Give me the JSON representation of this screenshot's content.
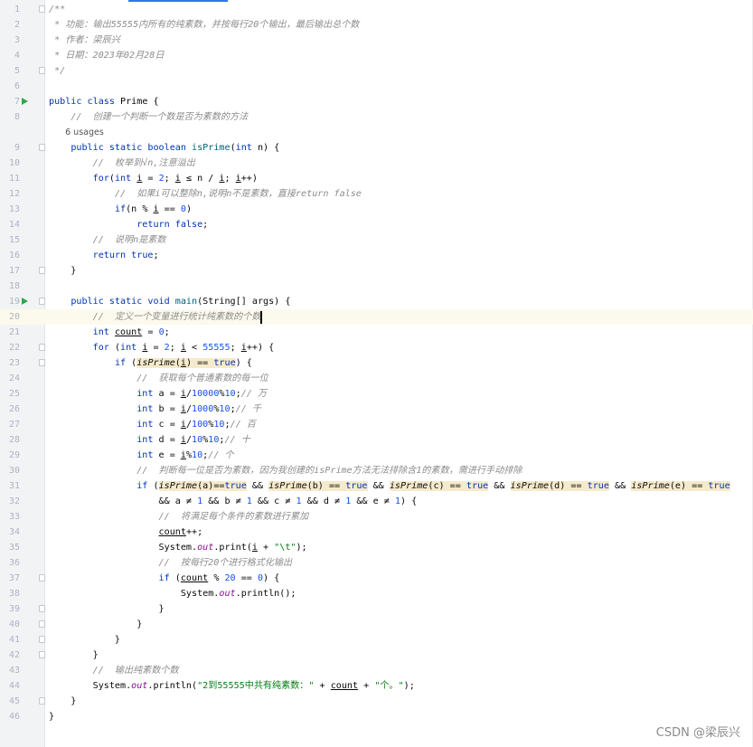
{
  "editor": {
    "language": "Java",
    "caret_line": 20,
    "run_lines": [
      7,
      19
    ],
    "fold_lines": [
      1,
      5,
      9,
      17,
      19,
      22,
      23,
      37,
      39,
      40,
      41,
      42,
      45
    ],
    "usages_before_line": 9,
    "usages_label": "6 usages",
    "lines": [
      [
        [
          "c",
          "/**"
        ]
      ],
      [
        [
          "c",
          " * 功能：输出55555内所有的纯素数，并按每行20个输出，最后输出总个数"
        ]
      ],
      [
        [
          "c",
          " * 作者：梁辰兴"
        ]
      ],
      [
        [
          "c",
          " * 日期：2023年02月28日"
        ]
      ],
      [
        [
          "c",
          " */"
        ]
      ],
      [],
      [
        [
          "k",
          "public class "
        ],
        [
          "p",
          "Prime {"
        ]
      ],
      [
        [
          "p",
          "    "
        ],
        [
          "c",
          "//  创建一个判断一个数是否为素数的方法"
        ]
      ],
      [
        [
          "p",
          "    "
        ],
        [
          "k",
          "public static boolean "
        ],
        [
          "d",
          "isPrime"
        ],
        [
          "p",
          "("
        ],
        [
          "k",
          "int"
        ],
        [
          "p",
          " n) {"
        ]
      ],
      [
        [
          "p",
          "        "
        ],
        [
          "c",
          "//  枚举到√n,注意溢出"
        ]
      ],
      [
        [
          "p",
          "        "
        ],
        [
          "k",
          "for"
        ],
        [
          "p",
          "("
        ],
        [
          "k",
          "int "
        ],
        [
          "u",
          "i"
        ],
        [
          "p",
          " = "
        ],
        [
          "n",
          "2"
        ],
        [
          "p",
          "; "
        ],
        [
          "u",
          "i"
        ],
        [
          "p",
          " ≤ n / "
        ],
        [
          "u",
          "i"
        ],
        [
          "p",
          "; "
        ],
        [
          "u",
          "i"
        ],
        [
          "p",
          "++)"
        ]
      ],
      [
        [
          "p",
          "            "
        ],
        [
          "c",
          "//  如果i可以整除n,说明n不是素数，直接return false"
        ]
      ],
      [
        [
          "p",
          "            "
        ],
        [
          "k",
          "if"
        ],
        [
          "p",
          "(n % "
        ],
        [
          "u",
          "i"
        ],
        [
          "p",
          " == "
        ],
        [
          "n",
          "0"
        ],
        [
          "p",
          ")"
        ]
      ],
      [
        [
          "p",
          "                "
        ],
        [
          "k",
          "return false"
        ],
        [
          "p",
          ";"
        ]
      ],
      [
        [
          "p",
          "        "
        ],
        [
          "c",
          "//  说明n是素数"
        ]
      ],
      [
        [
          "p",
          "        "
        ],
        [
          "k",
          "return true"
        ],
        [
          "p",
          ";"
        ]
      ],
      [
        [
          "p",
          "    }"
        ]
      ],
      [],
      [
        [
          "p",
          "    "
        ],
        [
          "k",
          "public static void "
        ],
        [
          "d",
          "main"
        ],
        [
          "p",
          "(String[] args) {"
        ]
      ],
      [
        [
          "p",
          "        "
        ],
        [
          "c",
          "//  定义一个变量进行统计纯素数的个数"
        ]
      ],
      [
        [
          "p",
          "        "
        ],
        [
          "k",
          "int "
        ],
        [
          "u",
          "count"
        ],
        [
          "p",
          " = "
        ],
        [
          "n",
          "0"
        ],
        [
          "p",
          ";"
        ]
      ],
      [
        [
          "p",
          "        "
        ],
        [
          "k",
          "for "
        ],
        [
          "p",
          "("
        ],
        [
          "k",
          "int "
        ],
        [
          "u",
          "i"
        ],
        [
          "p",
          " = "
        ],
        [
          "n",
          "2"
        ],
        [
          "p",
          "; "
        ],
        [
          "u",
          "i"
        ],
        [
          "p",
          " < "
        ],
        [
          "n",
          "55555"
        ],
        [
          "p",
          "; "
        ],
        [
          "u",
          "i"
        ],
        [
          "p",
          "++) {"
        ]
      ],
      [
        [
          "p",
          "            "
        ],
        [
          "k",
          "if "
        ],
        [
          "p",
          "("
        ],
        [
          "ih",
          "isPrime"
        ],
        [
          "ph",
          "("
        ],
        [
          "uh",
          "i"
        ],
        [
          "ph",
          ") == "
        ],
        [
          "kh",
          "true"
        ],
        [
          "p",
          ") {"
        ]
      ],
      [
        [
          "p",
          "                "
        ],
        [
          "c",
          "//  获取每个普通素数的每一位"
        ]
      ],
      [
        [
          "p",
          "                "
        ],
        [
          "k",
          "int "
        ],
        [
          "p",
          "a = "
        ],
        [
          "u",
          "i"
        ],
        [
          "p",
          "/"
        ],
        [
          "n",
          "10000"
        ],
        [
          "p",
          "%"
        ],
        [
          "n",
          "10"
        ],
        [
          "p",
          ";"
        ],
        [
          "c",
          "// 万"
        ]
      ],
      [
        [
          "p",
          "                "
        ],
        [
          "k",
          "int "
        ],
        [
          "p",
          "b = "
        ],
        [
          "u",
          "i"
        ],
        [
          "p",
          "/"
        ],
        [
          "n",
          "1000"
        ],
        [
          "p",
          "%"
        ],
        [
          "n",
          "10"
        ],
        [
          "p",
          ";"
        ],
        [
          "c",
          "// 千"
        ]
      ],
      [
        [
          "p",
          "                "
        ],
        [
          "k",
          "int "
        ],
        [
          "p",
          "c = "
        ],
        [
          "u",
          "i"
        ],
        [
          "p",
          "/"
        ],
        [
          "n",
          "100"
        ],
        [
          "p",
          "%"
        ],
        [
          "n",
          "10"
        ],
        [
          "p",
          ";"
        ],
        [
          "c",
          "// 百"
        ]
      ],
      [
        [
          "p",
          "                "
        ],
        [
          "k",
          "int "
        ],
        [
          "p",
          "d = "
        ],
        [
          "u",
          "i"
        ],
        [
          "p",
          "/"
        ],
        [
          "n",
          "10"
        ],
        [
          "p",
          "%"
        ],
        [
          "n",
          "10"
        ],
        [
          "p",
          ";"
        ],
        [
          "c",
          "// 十"
        ]
      ],
      [
        [
          "p",
          "                "
        ],
        [
          "k",
          "int "
        ],
        [
          "p",
          "e = "
        ],
        [
          "u",
          "i"
        ],
        [
          "p",
          "%"
        ],
        [
          "n",
          "10"
        ],
        [
          "p",
          ";"
        ],
        [
          "c",
          "// 个"
        ]
      ],
      [
        [
          "p",
          "                "
        ],
        [
          "c",
          "//  判断每一位是否为素数，因为我创建的isPrime方法无法排除含1的素数，需进行手动排除"
        ]
      ],
      [
        [
          "p",
          "                "
        ],
        [
          "k",
          "if "
        ],
        [
          "p",
          "("
        ],
        [
          "ih",
          "isPrime"
        ],
        [
          "ph",
          "(a)=="
        ],
        [
          "kh",
          "true"
        ],
        [
          "p",
          " && "
        ],
        [
          "ih",
          "isPrime"
        ],
        [
          "ph",
          "(b) == "
        ],
        [
          "kh",
          "true"
        ],
        [
          "p",
          " && "
        ],
        [
          "ih",
          "isPrime"
        ],
        [
          "ph",
          "(c) == "
        ],
        [
          "kh",
          "true"
        ],
        [
          "p",
          " && "
        ],
        [
          "ih",
          "isPrime"
        ],
        [
          "ph",
          "(d) == "
        ],
        [
          "kh",
          "true"
        ],
        [
          "p",
          " && "
        ],
        [
          "ih",
          "isPrime"
        ],
        [
          "ph",
          "(e) == "
        ],
        [
          "kh",
          "true"
        ]
      ],
      [
        [
          "p",
          "                    && a ≠ "
        ],
        [
          "n",
          "1"
        ],
        [
          "p",
          " && b ≠ "
        ],
        [
          "n",
          "1"
        ],
        [
          "p",
          " && c ≠ "
        ],
        [
          "n",
          "1"
        ],
        [
          "p",
          " && d ≠ "
        ],
        [
          "n",
          "1"
        ],
        [
          "p",
          " && e ≠ "
        ],
        [
          "n",
          "1"
        ],
        [
          "p",
          ") {"
        ]
      ],
      [
        [
          "p",
          "                    "
        ],
        [
          "c",
          "//  将满足每个条件的素数进行累加"
        ]
      ],
      [
        [
          "p",
          "                    "
        ],
        [
          "u",
          "count"
        ],
        [
          "p",
          "++;"
        ]
      ],
      [
        [
          "p",
          "                    System."
        ],
        [
          "f",
          "out"
        ],
        [
          "p",
          ".print("
        ],
        [
          "u",
          "i"
        ],
        [
          "p",
          " + "
        ],
        [
          "s",
          "\"\\t\""
        ],
        [
          "p",
          ");"
        ]
      ],
      [
        [
          "p",
          "                    "
        ],
        [
          "c",
          "//  按每行20个进行格式化输出"
        ]
      ],
      [
        [
          "p",
          "                    "
        ],
        [
          "k",
          "if "
        ],
        [
          "p",
          "("
        ],
        [
          "u",
          "count"
        ],
        [
          "p",
          " % "
        ],
        [
          "n",
          "20"
        ],
        [
          "p",
          " == "
        ],
        [
          "n",
          "0"
        ],
        [
          "p",
          ") {"
        ]
      ],
      [
        [
          "p",
          "                        System."
        ],
        [
          "f",
          "out"
        ],
        [
          "p",
          ".println();"
        ]
      ],
      [
        [
          "p",
          "                    }"
        ]
      ],
      [
        [
          "p",
          "                }"
        ]
      ],
      [
        [
          "p",
          "            }"
        ]
      ],
      [
        [
          "p",
          "        }"
        ]
      ],
      [
        [
          "p",
          "        "
        ],
        [
          "c",
          "//  输出纯素数个数"
        ]
      ],
      [
        [
          "p",
          "        System."
        ],
        [
          "f",
          "out"
        ],
        [
          "p",
          ".println("
        ],
        [
          "s",
          "\"2到55555中共有纯素数：\""
        ],
        [
          "p",
          " + "
        ],
        [
          "u",
          "count"
        ],
        [
          "p",
          " + "
        ],
        [
          "s",
          "\"个。\""
        ],
        [
          "p",
          ");"
        ]
      ],
      [
        [
          "p",
          "    }"
        ]
      ],
      [
        [
          "p",
          "}"
        ]
      ]
    ]
  },
  "watermark": "CSDN @梁辰兴"
}
